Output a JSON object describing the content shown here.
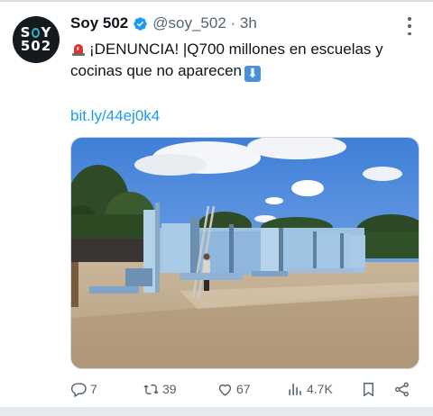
{
  "tweet": {
    "author_name": "Soy 502",
    "handle_time": "@soy_502 · 3h",
    "avatar": {
      "line1": "S",
      "line1b": "Y",
      "line2": "502"
    },
    "text_line1": "¡DENUNCIA! |Q700 millones en escuelas y",
    "text_line2": "cocinas que no aparecen",
    "link": "bit.ly/44ej0k4",
    "icons": {
      "siren": "siren-emoji",
      "arrow": "down-arrow-emoji",
      "verified": "verified-badge-icon",
      "more": "more-icon"
    }
  },
  "actions": {
    "replies": "7",
    "reposts": "39",
    "likes": "67",
    "views": "4.7K"
  },
  "colors": {
    "link": "#1d9bf0",
    "secondary": "#536471",
    "verified": "#1d9bf0"
  }
}
